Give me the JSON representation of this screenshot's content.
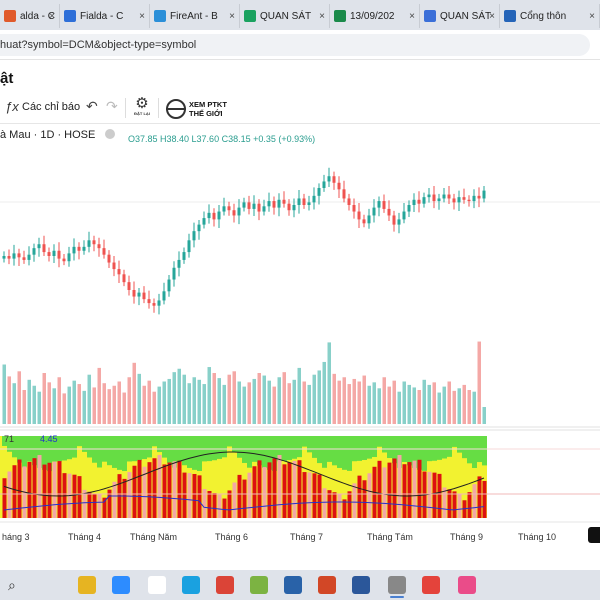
{
  "browser": {
    "tabs": [
      {
        "label": "alda - C",
        "icon_color": "#e05a2b",
        "icon": "fialda-icon"
      },
      {
        "label": "Fialda - C",
        "icon_color": "#2e6fd8",
        "icon": "fialda-icon"
      },
      {
        "label": "FireAnt - B",
        "icon_color": "#2b8fd8",
        "icon": "fireant-icon"
      },
      {
        "label": "QUAN SÁT",
        "icon_color": "#1aa260",
        "icon": "drive-icon"
      },
      {
        "label": "13/09/202",
        "icon_color": "#1a8a4a",
        "icon": "sheets-icon"
      },
      {
        "label": "QUAN SÁT",
        "icon_color": "#3b6fd8",
        "icon": "chrome-ext-icon"
      },
      {
        "label": "Cổng thôn",
        "icon_color": "#2464b8",
        "icon": "gov-portal-icon"
      }
    ],
    "close_glyph": "×",
    "url": "huat?symbol=DCM&object-type=symbol"
  },
  "page": {
    "title": "ật"
  },
  "toolbar": {
    "fx": "ƒx",
    "indicators_label": "Các chỉ báo",
    "undo": "↶",
    "redo": "↷",
    "reset_label": "ĐẶT LẠI",
    "ptkt_line1": "XEM PTKT",
    "ptkt_line2": "THẾ GIỚI"
  },
  "legend": {
    "symbol_text": "à Mau · 1D · HOSE",
    "ohlc": "O37.85  H38.40  L37.60  C38.15  +0.35 (+0.93%)"
  },
  "chart_data": {
    "type": "candlestick",
    "colors": {
      "up": "#26a69a",
      "down": "#ef5350",
      "vol_up": "#88d0c9",
      "vol_down": "#f4a8a6",
      "ind_green": "#66dd44",
      "ind_yellow": "#f2f230",
      "ind_red": "#dd1111",
      "ind_pink": "#f4a6a6"
    },
    "x_labels": [
      "háng 3",
      "Tháng 4",
      "Tháng Năm",
      "Tháng 6",
      "Tháng 7",
      "Tháng Tám",
      "Tháng 9",
      "Tháng 10"
    ],
    "closes": [
      31.2,
      31.0,
      31.4,
      31.1,
      30.9,
      31.3,
      31.8,
      32.1,
      31.5,
      31.2,
      31.6,
      31.0,
      30.8,
      31.4,
      31.9,
      31.6,
      31.9,
      32.4,
      32.1,
      31.8,
      31.3,
      30.7,
      30.2,
      29.8,
      29.2,
      28.6,
      28.1,
      28.4,
      27.9,
      27.6,
      27.4,
      27.8,
      28.5,
      29.4,
      30.3,
      30.9,
      31.5,
      32.4,
      33.1,
      33.6,
      34.1,
      34.5,
      34.0,
      34.6,
      35.0,
      34.7,
      34.3,
      34.9,
      35.3,
      34.8,
      35.2,
      34.6,
      35.0,
      35.4,
      34.9,
      35.5,
      35.2,
      34.7,
      35.1,
      35.6,
      35.1,
      35.3,
      35.8,
      36.4,
      36.9,
      37.3,
      36.8,
      36.3,
      35.6,
      35.1,
      34.6,
      34.0,
      33.7,
      34.3,
      34.9,
      35.4,
      34.8,
      34.3,
      33.6,
      34.0,
      34.6,
      35.1,
      35.5,
      35.2,
      35.7,
      35.9,
      35.4,
      35.6,
      35.9,
      35.6,
      35.3,
      35.7,
      35.5,
      35.4,
      35.8,
      35.6,
      36.2
    ],
    "volumes": [
      70,
      56,
      48,
      62,
      40,
      52,
      45,
      38,
      60,
      49,
      42,
      55,
      36,
      44,
      51,
      47,
      39,
      58,
      43,
      66,
      48,
      41,
      45,
      50,
      37,
      55,
      72,
      59,
      45,
      51,
      38,
      44,
      50,
      53,
      61,
      65,
      58,
      48,
      55,
      52,
      47,
      67,
      60,
      54,
      46,
      58,
      62,
      50,
      44,
      49,
      53,
      60,
      57,
      51,
      44,
      55,
      61,
      48,
      52,
      66,
      50,
      46,
      58,
      63,
      73,
      96,
      59,
      51,
      55,
      47,
      53,
      50,
      57,
      45,
      49,
      42,
      55,
      44,
      51,
      38,
      50,
      46,
      43,
      40,
      52,
      46,
      49,
      37,
      44,
      50,
      39,
      42,
      46,
      40,
      38,
      97,
      20
    ],
    "indicator": {
      "label_value": "4.45"
    },
    "ylim": [
      26,
      39
    ]
  }
}
